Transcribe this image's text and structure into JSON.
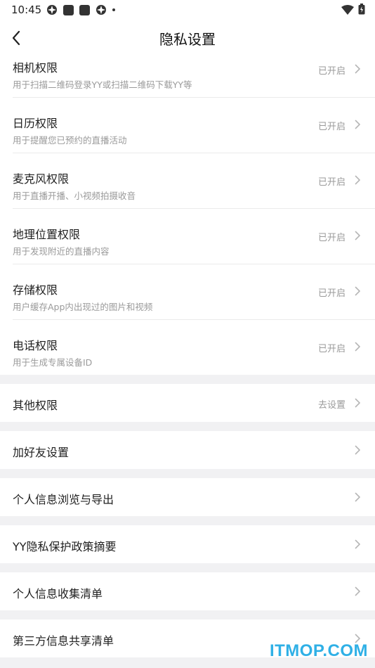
{
  "status_bar": {
    "time": "10:45",
    "left_icons": [
      "app-notification-icon",
      "square-notification-icon",
      "square-notification-icon",
      "app-notification-icon",
      "more-dot-icon"
    ],
    "right_icons": [
      "wifi-icon",
      "battery-icon"
    ]
  },
  "nav": {
    "back_icon": "chevron-left-icon",
    "title": "隐私设置"
  },
  "permissions": [
    {
      "title": "相机权限",
      "desc": "用于扫描二维码登录YY或扫描二维码下载YY等",
      "status": "已开启"
    },
    {
      "title": "日历权限",
      "desc": "用于提醒您已预约的直播活动",
      "status": "已开启"
    },
    {
      "title": "麦克风权限",
      "desc": "用于直播开播、小视频拍摄收音",
      "status": "已开启"
    },
    {
      "title": "地理位置权限",
      "desc": "用于发现附近的直播内容",
      "status": "已开启"
    },
    {
      "title": "存储权限",
      "desc": "用户缓存App内出现过的图片和视频",
      "status": "已开启"
    },
    {
      "title": "电话权限",
      "desc": "用于生成专属设备ID",
      "status": "已开启"
    }
  ],
  "other": {
    "title": "其他权限",
    "status": "去设置"
  },
  "settings_items": [
    {
      "title": "加好友设置"
    },
    {
      "title": "个人信息浏览与导出"
    },
    {
      "title": "YY隐私保护政策摘要"
    },
    {
      "title": "个人信息收集清单"
    },
    {
      "title": "第三方信息共享清单"
    }
  ],
  "watermark": "ITMOP.COM",
  "colors": {
    "accent_watermark": "#2fb0e6",
    "background": "#f1f1f3",
    "secondary_text": "#9a9a9a"
  }
}
